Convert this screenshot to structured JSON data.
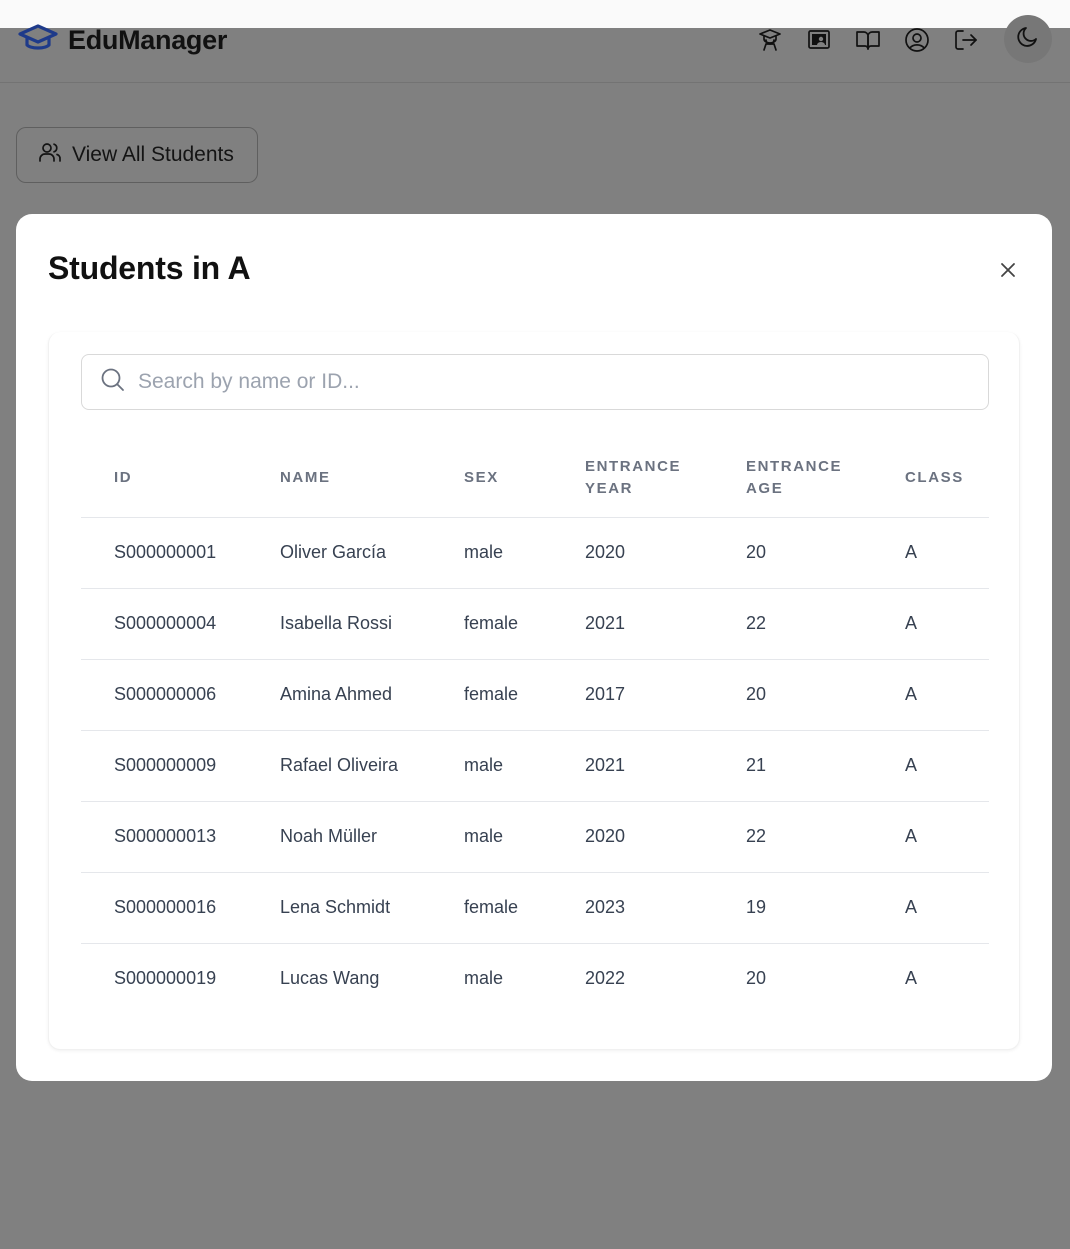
{
  "app": {
    "brand": "EduManager"
  },
  "nav": {
    "icons": [
      "graduation-teacher-icon",
      "presentation-icon",
      "book-open-icon",
      "user-circle-icon",
      "logout-icon"
    ],
    "theme_icon": "moon-icon"
  },
  "page": {
    "view_all_label": "View All Students"
  },
  "modal": {
    "title": "Students in A",
    "search_placeholder": "Search by name or ID...",
    "columns": {
      "id": "ID",
      "name": "NAME",
      "sex": "SEX",
      "entrance_year": "ENTRANCE YEAR",
      "entrance_age": "ENTRANCE AGE",
      "class": "CLASS"
    },
    "rows": [
      {
        "id": "S000000001",
        "name": "Oliver García",
        "sex": "male",
        "entrance_year": "2020",
        "entrance_age": "20",
        "class": "A"
      },
      {
        "id": "S000000004",
        "name": "Isabella Rossi",
        "sex": "female",
        "entrance_year": "2021",
        "entrance_age": "22",
        "class": "A"
      },
      {
        "id": "S000000006",
        "name": "Amina Ahmed",
        "sex": "female",
        "entrance_year": "2017",
        "entrance_age": "20",
        "class": "A"
      },
      {
        "id": "S000000009",
        "name": "Rafael Oliveira",
        "sex": "male",
        "entrance_year": "2021",
        "entrance_age": "21",
        "class": "A"
      },
      {
        "id": "S000000013",
        "name": "Noah Müller",
        "sex": "male",
        "entrance_year": "2020",
        "entrance_age": "22",
        "class": "A"
      },
      {
        "id": "S000000016",
        "name": "Lena Schmidt",
        "sex": "female",
        "entrance_year": "2023",
        "entrance_age": "19",
        "class": "A"
      },
      {
        "id": "S000000019",
        "name": "Lucas Wang",
        "sex": "male",
        "entrance_year": "2022",
        "entrance_age": "20",
        "class": "A"
      }
    ]
  },
  "colors": {
    "brand_icon": "#1e3a8a",
    "overlay": "#808080",
    "modal_bg": "#ffffff",
    "header_text": "#6b7280"
  }
}
